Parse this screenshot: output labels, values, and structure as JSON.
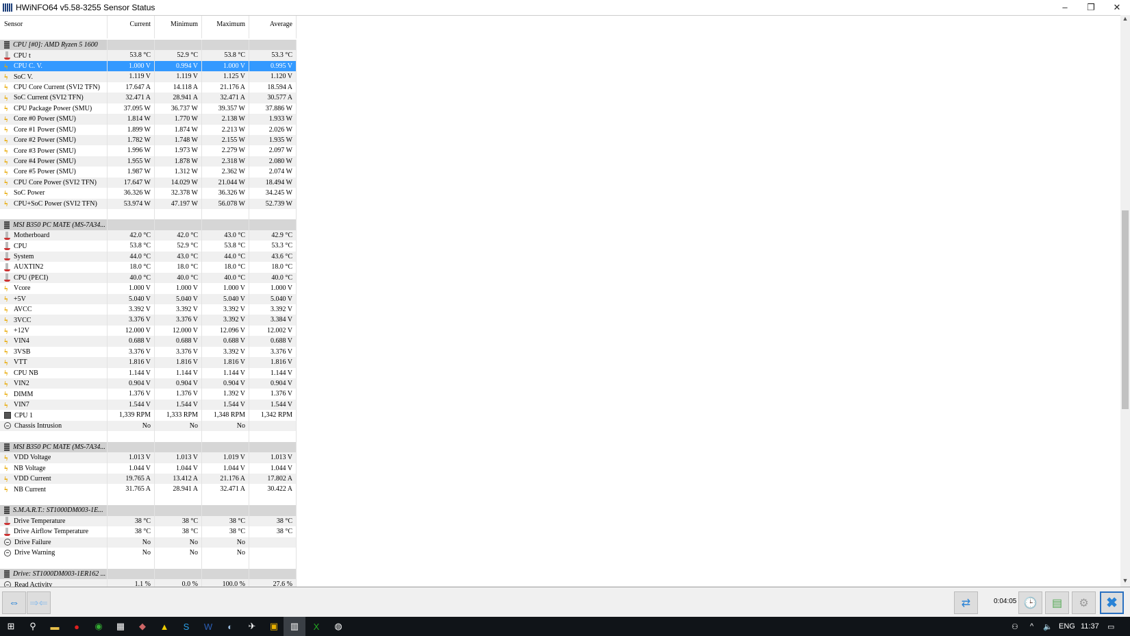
{
  "window": {
    "title": "HWiNFO64 v5.58-3255 Sensor Status",
    "minimize": "–",
    "restore": "❐",
    "close": "✕"
  },
  "columns": [
    "Sensor",
    "Current",
    "Minimum",
    "Maximum",
    "Average"
  ],
  "rows": [
    {
      "type": "group",
      "name": "CPU [#0]: AMD Ryzen 5 1600"
    },
    {
      "icon": "therm",
      "name": "CPU t",
      "v": [
        "53.8 °C",
        "52.9 °C",
        "53.8 °C",
        "53.3 °C"
      ]
    },
    {
      "icon": "volt",
      "name": "CPU C. V.",
      "v": [
        "1.000 V",
        "0.994 V",
        "1.000 V",
        "0.995 V"
      ],
      "selected": true
    },
    {
      "icon": "volt",
      "name": "SoC V.",
      "v": [
        "1.119 V",
        "1.119 V",
        "1.125 V",
        "1.120 V"
      ]
    },
    {
      "icon": "volt",
      "name": "CPU Core Current (SVI2 TFN)",
      "v": [
        "17.647 A",
        "14.118 A",
        "21.176 A",
        "18.594 A"
      ]
    },
    {
      "icon": "volt",
      "name": "SoC Current (SVI2 TFN)",
      "v": [
        "32.471 A",
        "28.941 A",
        "32.471 A",
        "30.577 A"
      ]
    },
    {
      "icon": "volt",
      "name": "CPU Package Power (SMU)",
      "v": [
        "37.095 W",
        "36.737 W",
        "39.357 W",
        "37.886 W"
      ]
    },
    {
      "icon": "volt",
      "name": "Core #0 Power (SMU)",
      "v": [
        "1.814 W",
        "1.770 W",
        "2.138 W",
        "1.933 W"
      ]
    },
    {
      "icon": "volt",
      "name": "Core #1 Power (SMU)",
      "v": [
        "1.899 W",
        "1.874 W",
        "2.213 W",
        "2.026 W"
      ]
    },
    {
      "icon": "volt",
      "name": "Core #2 Power (SMU)",
      "v": [
        "1.782 W",
        "1.748 W",
        "2.155 W",
        "1.935 W"
      ]
    },
    {
      "icon": "volt",
      "name": "Core #3 Power (SMU)",
      "v": [
        "1.996 W",
        "1.973 W",
        "2.279 W",
        "2.097 W"
      ]
    },
    {
      "icon": "volt",
      "name": "Core #4 Power (SMU)",
      "v": [
        "1.955 W",
        "1.878 W",
        "2.318 W",
        "2.080 W"
      ]
    },
    {
      "icon": "volt",
      "name": "Core #5 Power (SMU)",
      "v": [
        "1.987 W",
        "1.312 W",
        "2.362 W",
        "2.074 W"
      ]
    },
    {
      "icon": "volt",
      "name": "CPU Core Power (SVI2 TFN)",
      "v": [
        "17.647 W",
        "14.029 W",
        "21.044 W",
        "18.494 W"
      ]
    },
    {
      "icon": "volt",
      "name": "SoC Power",
      "v": [
        "36.326 W",
        "32.378 W",
        "36.326 W",
        "34.245 W"
      ]
    },
    {
      "icon": "volt",
      "name": "CPU+SoC Power (SVI2 TFN)",
      "v": [
        "53.974 W",
        "47.197 W",
        "56.078 W",
        "52.739 W"
      ]
    },
    {
      "type": "blank"
    },
    {
      "type": "group",
      "name": "MSI B350 PC MATE (MS-7A34..."
    },
    {
      "icon": "therm",
      "name": "Motherboard",
      "v": [
        "42.0 °C",
        "42.0 °C",
        "43.0 °C",
        "42.9 °C"
      ]
    },
    {
      "icon": "therm",
      "name": "CPU",
      "v": [
        "53.8 °C",
        "52.9 °C",
        "53.8 °C",
        "53.3 °C"
      ]
    },
    {
      "icon": "therm",
      "name": "System",
      "v": [
        "44.0 °C",
        "43.0 °C",
        "44.0 °C",
        "43.6 °C"
      ]
    },
    {
      "icon": "therm",
      "name": "AUXTIN2",
      "v": [
        "18.0 °C",
        "18.0 °C",
        "18.0 °C",
        "18.0 °C"
      ]
    },
    {
      "icon": "therm",
      "name": "CPU (PECI)",
      "v": [
        "40.0 °C",
        "40.0 °C",
        "40.0 °C",
        "40.0 °C"
      ]
    },
    {
      "icon": "volt",
      "name": "Vcore",
      "v": [
        "1.000 V",
        "1.000 V",
        "1.000 V",
        "1.000 V"
      ]
    },
    {
      "icon": "volt",
      "name": "+5V",
      "v": [
        "5.040 V",
        "5.040 V",
        "5.040 V",
        "5.040 V"
      ]
    },
    {
      "icon": "volt",
      "name": "AVCC",
      "v": [
        "3.392 V",
        "3.392 V",
        "3.392 V",
        "3.392 V"
      ]
    },
    {
      "icon": "volt",
      "name": "3VCC",
      "v": [
        "3.376 V",
        "3.376 V",
        "3.392 V",
        "3.384 V"
      ]
    },
    {
      "icon": "volt",
      "name": "+12V",
      "v": [
        "12.000 V",
        "12.000 V",
        "12.096 V",
        "12.002 V"
      ]
    },
    {
      "icon": "volt",
      "name": "VIN4",
      "v": [
        "0.688 V",
        "0.688 V",
        "0.688 V",
        "0.688 V"
      ]
    },
    {
      "icon": "volt",
      "name": "3VSB",
      "v": [
        "3.376 V",
        "3.376 V",
        "3.392 V",
        "3.376 V"
      ]
    },
    {
      "icon": "volt",
      "name": "VTT",
      "v": [
        "1.816 V",
        "1.816 V",
        "1.816 V",
        "1.816 V"
      ]
    },
    {
      "icon": "volt",
      "name": "CPU NB",
      "v": [
        "1.144 V",
        "1.144 V",
        "1.144 V",
        "1.144 V"
      ]
    },
    {
      "icon": "volt",
      "name": "VIN2",
      "v": [
        "0.904 V",
        "0.904 V",
        "0.904 V",
        "0.904 V"
      ]
    },
    {
      "icon": "volt",
      "name": "DIMM",
      "v": [
        "1.376 V",
        "1.376 V",
        "1.392 V",
        "1.376 V"
      ]
    },
    {
      "icon": "volt",
      "name": "VIN7",
      "v": [
        "1.544 V",
        "1.544 V",
        "1.544 V",
        "1.544 V"
      ]
    },
    {
      "icon": "fan",
      "name": "CPU 1",
      "v": [
        "1,339 RPM",
        "1,333 RPM",
        "1,348 RPM",
        "1,342 RPM"
      ]
    },
    {
      "icon": "bool",
      "name": "Chassis Intrusion",
      "v": [
        "No",
        "No",
        "No",
        ""
      ]
    },
    {
      "type": "blank"
    },
    {
      "type": "group",
      "name": "MSI B350 PC MATE (MS-7A34..."
    },
    {
      "icon": "volt",
      "name": "VDD Voltage",
      "v": [
        "1.013 V",
        "1.013 V",
        "1.019 V",
        "1.013 V"
      ]
    },
    {
      "icon": "volt",
      "name": "NB Voltage",
      "v": [
        "1.044 V",
        "1.044 V",
        "1.044 V",
        "1.044 V"
      ]
    },
    {
      "icon": "volt",
      "name": "VDD Current",
      "v": [
        "19.765 A",
        "13.412 A",
        "21.176 A",
        "17.802 A"
      ]
    },
    {
      "icon": "volt",
      "name": "NB Current",
      "v": [
        "31.765 A",
        "28.941 A",
        "32.471 A",
        "30.422 A"
      ]
    },
    {
      "type": "blank"
    },
    {
      "type": "group",
      "name": "S.M.A.R.T.: ST1000DM003-1E..."
    },
    {
      "icon": "therm",
      "name": "Drive Temperature",
      "v": [
        "38 °C",
        "38 °C",
        "38 °C",
        "38 °C"
      ]
    },
    {
      "icon": "therm",
      "name": "Drive Airflow Temperature",
      "v": [
        "38 °C",
        "38 °C",
        "38 °C",
        "38 °C"
      ]
    },
    {
      "icon": "bool",
      "name": "Drive Failure",
      "v": [
        "No",
        "No",
        "No",
        ""
      ]
    },
    {
      "icon": "bool",
      "name": "Drive Warning",
      "v": [
        "No",
        "No",
        "No",
        ""
      ]
    },
    {
      "type": "blank"
    },
    {
      "type": "group",
      "name": "Drive: ST1000DM003-1ER162 ..."
    },
    {
      "icon": "bool",
      "name": "Read Activity",
      "v": [
        "1.1 %",
        "0.0 %",
        "100.0 %",
        "27.6 %"
      ]
    }
  ],
  "toolbar": {
    "timer": "0:04:05"
  },
  "taskbar": {
    "lang": "ENG",
    "time": "11:37"
  },
  "colors": {
    "selected": "#3399ff",
    "group": "#d6d6d6",
    "accent": "#2a83d6"
  }
}
